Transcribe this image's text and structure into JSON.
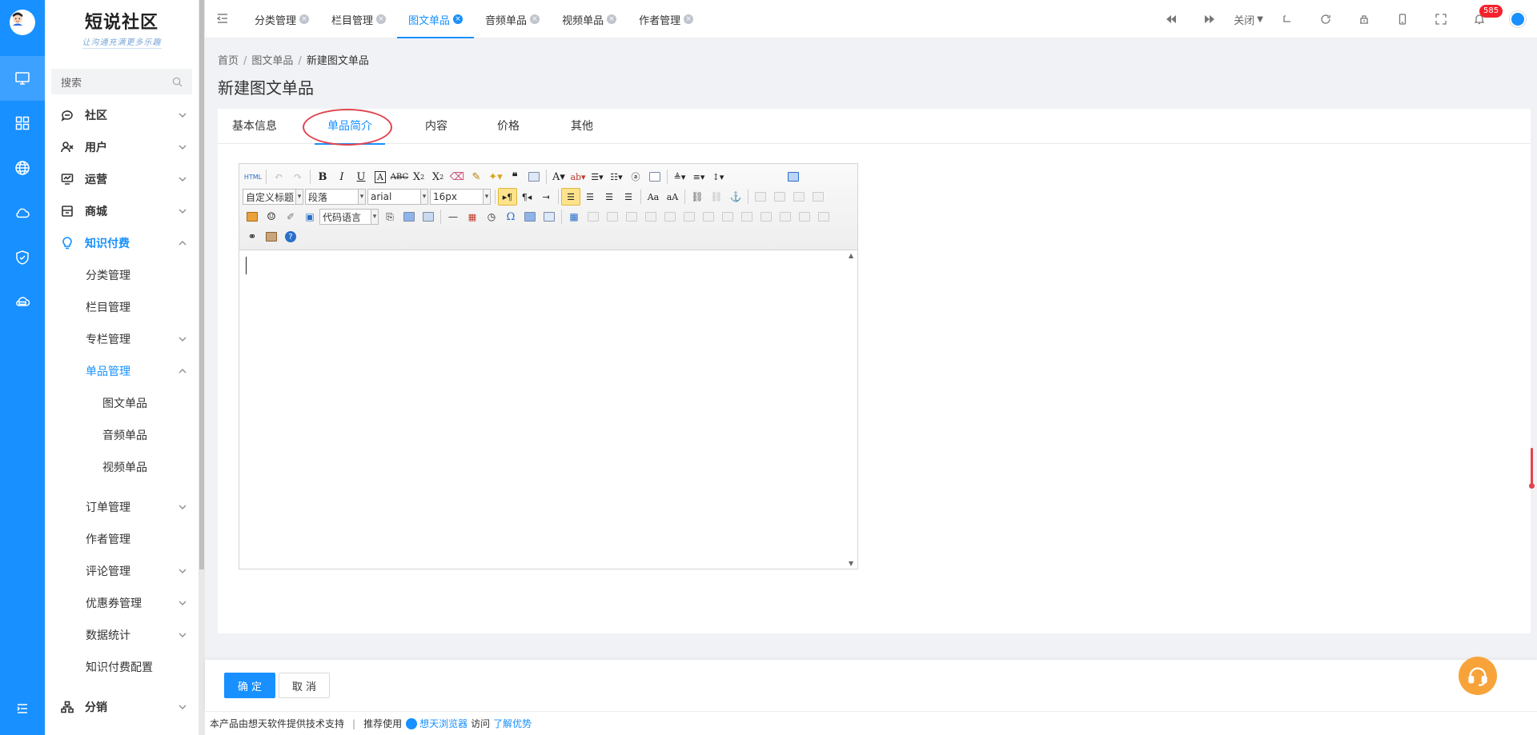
{
  "brand": {
    "title": "短说社区",
    "slogan": "让沟通充满更多乐趣"
  },
  "search": {
    "placeholder": "搜索"
  },
  "menu": [
    {
      "label": "社区",
      "key": "shequ"
    },
    {
      "label": "用户",
      "key": "yonghu"
    },
    {
      "label": "运营",
      "key": "yunying"
    },
    {
      "label": "商城",
      "key": "shangcheng"
    },
    {
      "label": "知识付费",
      "key": "zhishi"
    },
    {
      "label": "分类管理"
    },
    {
      "label": "栏目管理"
    },
    {
      "label": "专栏管理"
    },
    {
      "label": "单品管理"
    },
    {
      "label": "图文单品"
    },
    {
      "label": "音频单品"
    },
    {
      "label": "视频单品"
    },
    {
      "label": "订单管理"
    },
    {
      "label": "作者管理"
    },
    {
      "label": "评论管理"
    },
    {
      "label": "优惠券管理"
    },
    {
      "label": "数据统计"
    },
    {
      "label": "知识付费配置"
    },
    {
      "label": "分销",
      "key": "fenxiao"
    }
  ],
  "tabs": [
    {
      "label": "分类管理"
    },
    {
      "label": "栏目管理"
    },
    {
      "label": "图文单品"
    },
    {
      "label": "音频单品"
    },
    {
      "label": "视频单品"
    },
    {
      "label": "作者管理"
    }
  ],
  "toolbar": {
    "close_label": "关闭",
    "notify_count": "585"
  },
  "breadcrumb": [
    "首页",
    "图文单品",
    "新建图文单品"
  ],
  "page_title": "新建图文单品",
  "form_tabs": [
    "基本信息",
    "单品简介",
    "内容",
    "价格",
    "其他"
  ],
  "active_form_tab": "单品简介",
  "editor": {
    "html_label": "HTML",
    "style_select": "自定义标题",
    "para_select": "段落",
    "font_select": "arial",
    "size_select": "16px",
    "code_select": "代码语言"
  },
  "actions": {
    "confirm": "确 定",
    "cancel": "取 消"
  },
  "footer": {
    "text1": "本产品由想天软件提供技术支持",
    "sep": "|",
    "recommend": "推荐使用",
    "browser": "想天浏览器",
    "visit": "访问",
    "learn": "了解优势"
  },
  "colors": {
    "primary": "#1890ff",
    "highlight_circle": "#e0444f",
    "support": "#f7a33a"
  }
}
